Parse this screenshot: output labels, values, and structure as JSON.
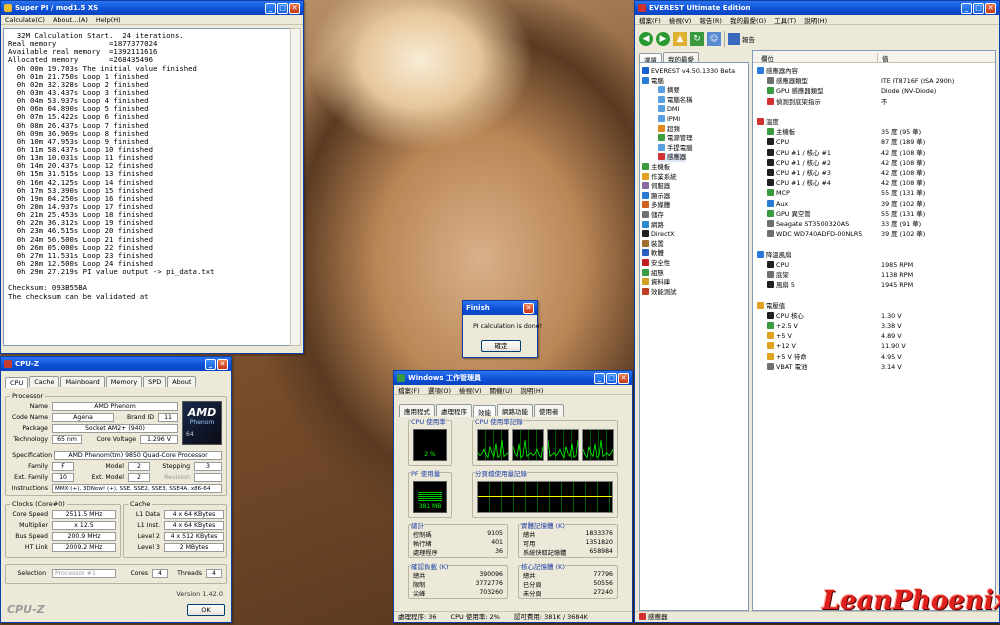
{
  "superpi": {
    "title": "Super PI / mod1.5 XS",
    "menu": [
      "Calculate(C)",
      "About...(A)",
      "Help(H)"
    ],
    "lines": [
      "  32M Calculation Start.  24 iterations.",
      "Real memory            =1877377024",
      "Available real memory  =1392111616",
      "Allocated memory       =268435496",
      "  0h 00m 19.703s The initial value finished",
      "  0h 01m 21.750s Loop 1 finished",
      "  0h 02m 32.328s Loop 2 finished",
      "  0h 03m 43.437s Loop 3 finished",
      "  0h 04m 53.937s Loop 4 finished",
      "  0h 06m 04.890s Loop 5 finished",
      "  0h 07m 15.422s Loop 6 finished",
      "  0h 08m 26.437s Loop 7 finished",
      "  0h 09m 36.969s Loop 8 finished",
      "  0h 10m 47.953s Loop 9 finished",
      "  0h 11m 58.437s Loop 10 finished",
      "  0h 13m 10.031s Loop 11 finished",
      "  0h 14m 20.437s Loop 12 finished",
      "  0h 15m 31.515s Loop 13 finished",
      "  0h 16m 42.125s Loop 14 finished",
      "  0h 17m 53.390s Loop 15 finished",
      "  0h 19m 04.250s Loop 16 finished",
      "  0h 20m 14.937s Loop 17 finished",
      "  0h 21m 25.453s Loop 18 finished",
      "  0h 22m 36.312s Loop 19 finished",
      "  0h 23m 46.515s Loop 20 finished",
      "  0h 24m 56.500s Loop 21 finished",
      "  0h 26m 05.000s Loop 22 finished",
      "  0h 27m 11.531s Loop 23 finished",
      "  0h 28m 12.500s Loop 24 finished",
      "  0h 29m 27.219s PI value output -> pi_data.txt",
      "",
      "Checksum: 093B55BA",
      "The checksum can be validated at"
    ]
  },
  "finish": {
    "title": "Finish",
    "message": "PI calculation is done!",
    "ok": "確定"
  },
  "cpuz": {
    "title": "CPU-Z",
    "tabs": [
      "CPU",
      "Cache",
      "Mainboard",
      "Memory",
      "SPD",
      "About"
    ],
    "processor_label": "Processor",
    "name_l": "Name",
    "name": "AMD Phenom",
    "codename_l": "Code Name",
    "codename": "Agena",
    "brandid_l": "Brand ID",
    "brandid": "11",
    "package_l": "Package",
    "package": "Socket AM2+ (940)",
    "tech_l": "Technology",
    "tech": "65 nm",
    "cv_l": "Core Voltage",
    "cv": "1.296 V",
    "spec_l": "Specification",
    "spec": "AMD Phenom(tm) 9850 Quad-Core Processor",
    "family_l": "Family",
    "family": "F",
    "model_l": "Model",
    "model": "2",
    "stepping_l": "Stepping",
    "stepping": "3",
    "extfam_l": "Ext. Family",
    "extfam": "10",
    "extmod_l": "Ext. Model",
    "extmod": "2",
    "rev_l": "Revision",
    "rev": "",
    "instr_l": "Instructions",
    "instr": "MMX (+), 3DNow! (+), SSE, SSE2, SSE3, SSE4A, x86-64",
    "clocks_label": "Clocks (Core#0)",
    "cs_l": "Core Speed",
    "cs": "2511.5 MHz",
    "mult_l": "Multiplier",
    "mult": "x 12.5",
    "bus_l": "Bus Speed",
    "bus": "200.9 MHz",
    "ht_l": "HT Link",
    "ht": "2009.2 MHz",
    "cache_label": "Cache",
    "l1d_l": "L1 Data",
    "l1d": "4 x 64 KBytes",
    "l1i_l": "L1 Inst.",
    "l1i": "4 x 64 KBytes",
    "l2_l": "Level 2",
    "l2": "4 x 512 KBytes",
    "l3_l": "Level 3",
    "l3": "2 MBytes",
    "sel_l": "Selection",
    "sel": "Processor #1",
    "cores_l": "Cores",
    "cores": "4",
    "threads_l": "Threads",
    "threads": "4",
    "version": "Version 1.42.0",
    "brand": "CPU-Z",
    "ok": "OK",
    "logo_brand": "AMD",
    "logo_sub": "Phenom",
    "logo_num": "64"
  },
  "taskman": {
    "title": "Windows 工作管理員",
    "menu": [
      "檔案(F)",
      "選項(O)",
      "檢視(V)",
      "關機(U)",
      "說明(H)"
    ],
    "tabs": [
      "應用程式",
      "處理程序",
      "效能",
      "網路功能",
      "使用者"
    ],
    "cpu_usage_l": "CPU 使用率",
    "cpu_usage": "2 %",
    "cpu_hist_l": "CPU 使用率記錄",
    "pf_l": "PF 使用量",
    "pf": "381 MB",
    "pf_hist_l": "分頁檔使用量記錄",
    "totals_l": "總計",
    "handles_l": "控制碼",
    "handles": "9105",
    "threads_l": "執行緒",
    "threads": "401",
    "procs_l": "處理程序",
    "procs": "36",
    "phys_l": "實體記憶體 (K)",
    "phys_total_l": "總共",
    "phys_total": "1833376",
    "phys_avail_l": "可用",
    "phys_avail": "1351820",
    "phys_cache_l": "系統快取記憶體",
    "phys_cache": "658984",
    "commit_l": "確認負載 (K)",
    "commit_total_l": "總共",
    "commit_total": "390096",
    "commit_limit_l": "限制",
    "commit_limit": "3772776",
    "commit_peak_l": "尖峰",
    "commit_peak": "703260",
    "kernel_l": "核心記憶體 (K)",
    "kernel_total_l": "總共",
    "kernel_total": "77796",
    "kernel_paged_l": "已分頁",
    "kernel_paged": "50556",
    "kernel_np_l": "未分頁",
    "kernel_np": "27240",
    "status_procs": "處理程序: 36",
    "status_cpu": "CPU 使用率: 2%",
    "status_commit": "認可費用: 381K / 3684K",
    "cpu_history": [
      0.08,
      0.15,
      0.22,
      0.12,
      0.18
    ]
  },
  "everest": {
    "title": "EVEREST Ultimate Edition",
    "menu": [
      "檔案(F)",
      "檢視(V)",
      "報告(R)",
      "我的最愛(O)",
      "工具(T)",
      "說明(H)"
    ],
    "report_btn": "報告",
    "tabs": [
      "選單",
      "我的最愛"
    ],
    "tree": [
      {
        "t": "EVEREST v4.50.1330 Beta",
        "lv": 0,
        "c": "#1b60d0"
      },
      {
        "t": "電腦",
        "lv": 0,
        "c": "#2a7ad8"
      },
      {
        "t": "摘要",
        "lv": 1,
        "c": "#5aa0e0"
      },
      {
        "t": "電腦名稱",
        "lv": 1,
        "c": "#5aa0e0"
      },
      {
        "t": "DMI",
        "lv": 1,
        "c": "#5aa0e0"
      },
      {
        "t": "IPMI",
        "lv": 1,
        "c": "#5aa0e0"
      },
      {
        "t": "超頻",
        "lv": 1,
        "c": "#e08a20"
      },
      {
        "t": "電源管理",
        "lv": 1,
        "c": "#3aa040"
      },
      {
        "t": "手提電腦",
        "lv": 1,
        "c": "#5aa0e0"
      },
      {
        "t": "感應器",
        "lv": 1,
        "c": "#d03030"
      },
      {
        "t": "主機板",
        "lv": 0,
        "c": "#3a9a40"
      },
      {
        "t": "作業系統",
        "lv": 0,
        "c": "#e0a020"
      },
      {
        "t": "伺服器",
        "lv": 0,
        "c": "#8a6aa0"
      },
      {
        "t": "顯示器",
        "lv": 0,
        "c": "#2a7ad8"
      },
      {
        "t": "多媒體",
        "lv": 0,
        "c": "#d06020"
      },
      {
        "t": "儲存",
        "lv": 0,
        "c": "#707070"
      },
      {
        "t": "網路",
        "lv": 0,
        "c": "#2a8ad0"
      },
      {
        "t": "DirectX",
        "lv": 0,
        "c": "#202020"
      },
      {
        "t": "裝置",
        "lv": 0,
        "c": "#a07030"
      },
      {
        "t": "軟體",
        "lv": 0,
        "c": "#2a60c0"
      },
      {
        "t": "安全性",
        "lv": 0,
        "c": "#c02020"
      },
      {
        "t": "組態",
        "lv": 0,
        "c": "#3a9a40"
      },
      {
        "t": "資料庫",
        "lv": 0,
        "c": "#d0a020"
      },
      {
        "t": "效能測試",
        "lv": 0,
        "c": "#c04020"
      }
    ],
    "col_item": "欄位",
    "col_value": "值",
    "rows": [
      {
        "k": "感應器內容",
        "v": "",
        "h": true,
        "c": "#2a7ad8"
      },
      {
        "k": "感應器類型",
        "v": "ITE IT8716F (ISA 290h)",
        "c": "#707070"
      },
      {
        "k": "GPU 感應器類型",
        "v": "Diode (NV-Diode)",
        "c": "#3a9a40"
      },
      {
        "k": "偵測到底架指示",
        "v": "不",
        "c": "#d03030"
      },
      {
        "k": "",
        "v": "",
        "sp": true
      },
      {
        "k": "溫度",
        "v": "",
        "h": true,
        "c": "#d03030"
      },
      {
        "k": "主機板",
        "v": "35 度 (95 華)",
        "c": "#3a9a40"
      },
      {
        "k": "CPU",
        "v": "87 度 (189 華)",
        "c": "#202020"
      },
      {
        "k": "CPU #1 / 核心 #1",
        "v": "42 度 (108 華)",
        "c": "#202020"
      },
      {
        "k": "CPU #1 / 核心 #2",
        "v": "42 度 (108 華)",
        "c": "#202020"
      },
      {
        "k": "CPU #1 / 核心 #3",
        "v": "42 度 (108 華)",
        "c": "#202020"
      },
      {
        "k": "CPU #1 / 核心 #4",
        "v": "42 度 (108 華)",
        "c": "#202020"
      },
      {
        "k": "MCP",
        "v": "55 度 (131 華)",
        "c": "#3a9a40"
      },
      {
        "k": "Aux",
        "v": "39 度 (102 華)",
        "c": "#2a7ad8"
      },
      {
        "k": "GPU 異空管",
        "v": "55 度 (131 華)",
        "c": "#3a9a40"
      },
      {
        "k": "Seagate ST3500320AS",
        "v": "33 度 (91 華)",
        "c": "#707070"
      },
      {
        "k": "WDC WD740ADFD-00NLR5",
        "v": "39 度 (102 華)",
        "c": "#707070"
      },
      {
        "k": "",
        "v": "",
        "sp": true
      },
      {
        "k": "降溫風扇",
        "v": "",
        "h": true,
        "c": "#2a7ad8"
      },
      {
        "k": "CPU",
        "v": "1985 RPM",
        "c": "#202020"
      },
      {
        "k": "底架",
        "v": "1138 RPM",
        "c": "#707070"
      },
      {
        "k": "風扇 5",
        "v": "1945 RPM",
        "c": "#202020"
      },
      {
        "k": "",
        "v": "",
        "sp": true
      },
      {
        "k": "電壓值",
        "v": "",
        "h": true,
        "c": "#e0a020"
      },
      {
        "k": "CPU 核心",
        "v": "1.30 V",
        "c": "#202020"
      },
      {
        "k": "+2.5 V",
        "v": "3.38 V",
        "c": "#3a9a40"
      },
      {
        "k": "+5 V",
        "v": "4.89 V",
        "c": "#e0a020"
      },
      {
        "k": "+12 V",
        "v": "11.90 V",
        "c": "#e0a020"
      },
      {
        "k": "+5 V 待命",
        "v": "4.95 V",
        "c": "#e0a020"
      },
      {
        "k": "VBAT 電池",
        "v": "3.14 V",
        "c": "#707070"
      }
    ],
    "status": "感應器"
  },
  "signature": "LeanPhoenix"
}
